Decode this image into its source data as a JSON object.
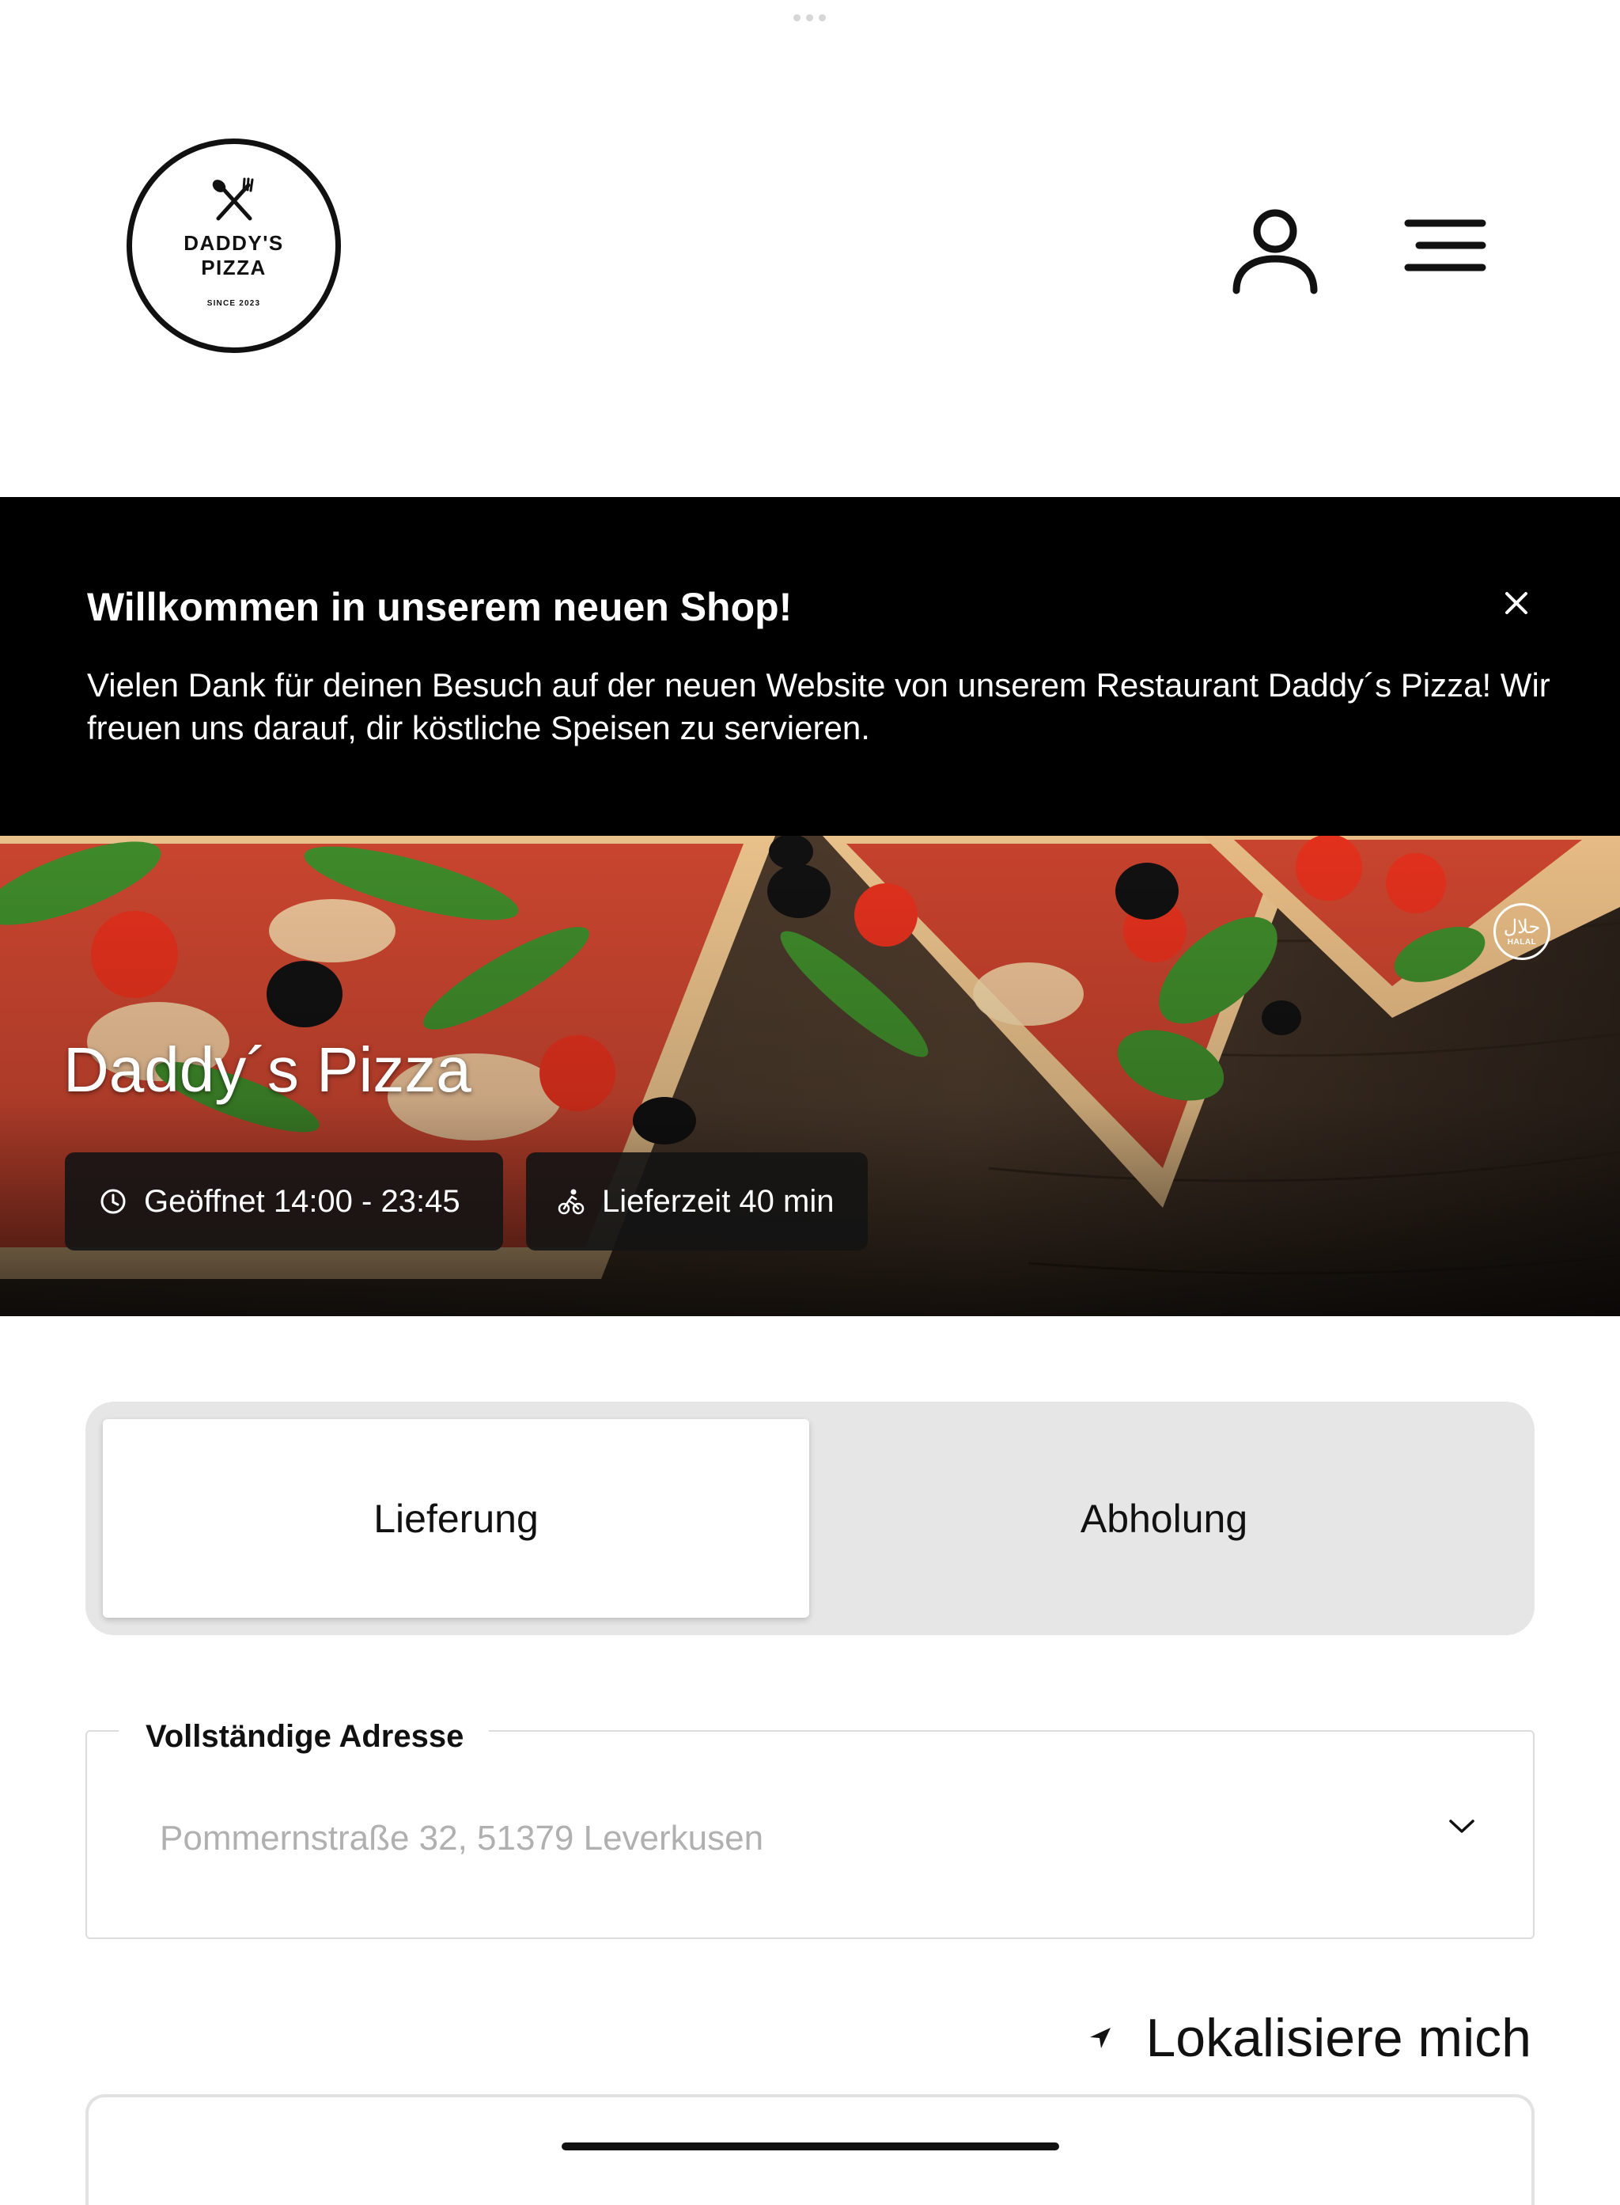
{
  "header": {
    "logo": {
      "line1": "DADDY'S",
      "line2": "PIZZA",
      "tagline": "SINCE 2023"
    },
    "icons": [
      "user-icon",
      "menu-icon"
    ]
  },
  "banner": {
    "title": "Willkommen in unserem neuen Shop!",
    "text": "Vielen Dank für deinen Besuch auf der neuen Website von unserem Restaurant Daddy´s Pizza! Wir freuen uns darauf, dir köstliche Speisen zu servieren.",
    "close_icon": "close-icon"
  },
  "hero": {
    "title": "Daddy´s Pizza",
    "opening_hours": "Geöffnet 14:00 - 23:45",
    "delivery_time": "Lieferzeit 40 min",
    "badge": {
      "arabic": "حلال",
      "label": "HALAL"
    }
  },
  "order_mode": {
    "options": [
      "Lieferung",
      "Abholung"
    ],
    "selected": "Lieferung"
  },
  "address": {
    "label": "Vollständige Adresse",
    "placeholder": "Pommernstraße 32, 51379 Leverkusen",
    "chevron_icon": "chevron-down-icon"
  },
  "locate": {
    "label": "Lokalisiere mich",
    "icon": "location-arrow-icon"
  }
}
